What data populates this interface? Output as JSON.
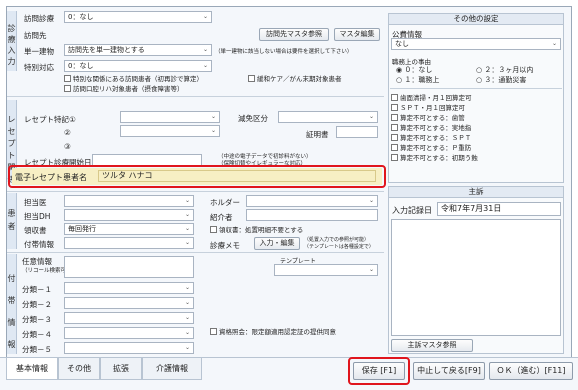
{
  "left_top": {
    "side_label": "診療入力",
    "houmon_shinsatsu_label": "訪問診療",
    "houmon_shinsatsu_value": "0：なし",
    "houmonsaki_label": "訪問先",
    "houmonsaki_master_btn": "訪問先マスタ参照",
    "master_edit_btn": "マスタ編集",
    "tanitsu_label": "単一建物",
    "tanitsu_value": "訪問先を単一建物とする",
    "tanitsu_note": "（単一建物に該当しない場合は要件を選択して下さい）",
    "tokubetsu_label": "特別対応",
    "tokubetsu_value": "0：なし",
    "chk_tokubetsu_kankei": "特別な関係にある訪問患者（初再診で算定）",
    "chk_kanwa_care": "緩和ケア／がん末期対象患者",
    "chk_houmon_kokuin": "訪問口腔リハ対象患者（摂食障害等）"
  },
  "receipt": {
    "side_label": "レセプト関係",
    "tokki_label": "レセプト特記①",
    "tokki_2": "②",
    "tokki_3": "③",
    "genmen_label": "減免区分",
    "shomeisho_label": "証明書",
    "start_label": "レセプト診療開始日",
    "start_note_1": "（中途の電子データで初診料がない）",
    "start_note_2": "（保険切替やイレギュラーな対応）",
    "denshi_label": "電子レセプト患者名",
    "denshi_value": "ツルタ ハナコ"
  },
  "kanja": {
    "side_label": "患者",
    "tantoui_label": "担当医",
    "tantodh_label": "担当DH",
    "ryoshusho_label": "領収書",
    "ryoshusho_value": "毎回発行",
    "fushou_label": "付帯情報",
    "holder_label": "ホルダー",
    "shokaisha_label": "紹介者",
    "chk_ryoshusho_meisai": "領収書：処置明細不要とする",
    "shinryo_memo_label": "診療メモ",
    "nyuryoku_btn": "入力・編集",
    "memo_note_1": "（処置入力での参照が可能）",
    "memo_note_2": "（テンプレートは各種設定で）"
  },
  "ninni": {
    "side_label": "付帯情報",
    "ninni_label": "任意情報",
    "ninni_sub": "（リコール検索可）",
    "template_label": "テンプレート",
    "bunrui": [
      "分類－１",
      "分類－２",
      "分類－３",
      "分類－４",
      "分類－５"
    ],
    "chk_shikaku": "資格照会：限定額適用認定証の提供同意"
  },
  "sonota": {
    "title": "その他の設定",
    "kouhi_label": "公費情報",
    "kouhi_value": "なし",
    "shokumu_label": "職務上の事由",
    "radios": [
      "０：なし",
      "２：３ヶ月以内",
      "１：職務上",
      "３：通勤災害"
    ],
    "checks": [
      "歯面清掃・月１回算定可",
      "ＳＰＴ・月１回算定可",
      "算定不可とする：歯管",
      "算定不可とする：実地指",
      "算定不可とする：ＳＰＴ",
      "算定不可とする：Ｐ重防",
      "算定不可とする：初期う蝕"
    ]
  },
  "shusho": {
    "title": "主訴",
    "kiroku_label": "入力記録日",
    "kiroku_value": "令和7年7月31日",
    "master_btn": "主訴マスタ参照"
  },
  "tabs": [
    "基本情報",
    "その他",
    "拡張",
    "介護情報"
  ],
  "footer": {
    "save": "保存 [F1]",
    "cancel": "中止して戻る[F9]",
    "ok": "ＯＫ（進む）[F11]"
  },
  "colors": {
    "highlight_red": "#e0151d",
    "name_bg": "#f7efc4"
  }
}
